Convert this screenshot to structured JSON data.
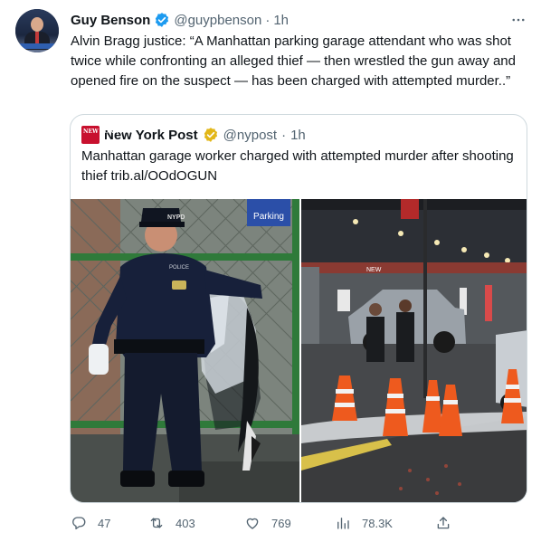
{
  "tweet": {
    "author_name": "Guy Benson",
    "handle": "@guypbenson",
    "separator": "·",
    "time": "1h",
    "text": "Alvin Bragg justice: “A Manhattan parking garage attendant who was shot twice while confronting an alleged thief — then wrestled the gun away and opened fire on the suspect — has been charged with attempted murder..”"
  },
  "quote": {
    "logo_text": "NEW YORK POST",
    "author_name": "New York Post",
    "handle": "@nypost",
    "separator": "·",
    "time": "1h",
    "text": "Manhattan garage worker charged with attempted murder after shooting thief trib.al/OOdOGUN",
    "images": {
      "left_signs": [
        "NYPD",
        "POLICE",
        "Parking"
      ],
      "right_signs": [
        "NEW"
      ]
    }
  },
  "actions": {
    "replies": "47",
    "retweets": "403",
    "likes": "769",
    "views": "78.3K"
  },
  "colors": {
    "verified_blue": "#1d9bf0",
    "verified_gold": "#e2b719",
    "secondary_text": "#536471",
    "border": "#cfd9de"
  },
  "icons": [
    "verified-badge-icon",
    "more-icon",
    "reply-icon",
    "retweet-icon",
    "like-icon",
    "views-icon",
    "share-icon"
  ]
}
